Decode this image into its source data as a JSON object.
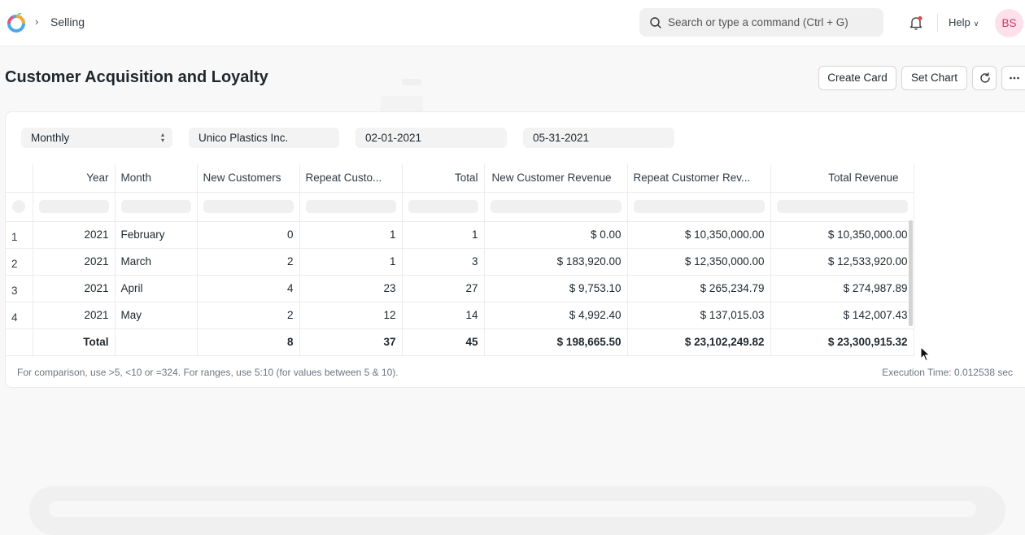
{
  "navbar": {
    "breadcrumb": "Selling",
    "search_placeholder": "Search or type a command (Ctrl + G)",
    "help_label": "Help",
    "avatar_initials": "BS"
  },
  "page": {
    "title": "Customer Acquisition and Loyalty",
    "buttons": {
      "create_card": "Create Card",
      "set_chart": "Set Chart"
    }
  },
  "filters": {
    "period": "Monthly",
    "customer": "Unico Plastics Inc.",
    "from_date": "02-01-2021",
    "to_date": "05-31-2021"
  },
  "table": {
    "columns": [
      "Year",
      "Month",
      "New Customers",
      "Repeat Custo...",
      "Total",
      "New Customer Revenue",
      "Repeat Customer Rev...",
      "Total Revenue"
    ],
    "rows": [
      {
        "no": "1",
        "year": "2021",
        "month": "February",
        "new_customers": "0",
        "repeat_customers": "1",
        "total": "1",
        "new_revenue": "$ 0.00",
        "repeat_revenue": "$ 10,350,000.00",
        "total_revenue": "$ 10,350,000.00"
      },
      {
        "no": "2",
        "year": "2021",
        "month": "March",
        "new_customers": "2",
        "repeat_customers": "1",
        "total": "3",
        "new_revenue": "$ 183,920.00",
        "repeat_revenue": "$ 12,350,000.00",
        "total_revenue": "$ 12,533,920.00"
      },
      {
        "no": "3",
        "year": "2021",
        "month": "April",
        "new_customers": "4",
        "repeat_customers": "23",
        "total": "27",
        "new_revenue": "$ 9,753.10",
        "repeat_revenue": "$ 265,234.79",
        "total_revenue": "$ 274,987.89"
      },
      {
        "no": "4",
        "year": "2021",
        "month": "May",
        "new_customers": "2",
        "repeat_customers": "12",
        "total": "14",
        "new_revenue": "$ 4,992.40",
        "repeat_revenue": "$ 137,015.03",
        "total_revenue": "$ 142,007.43"
      }
    ],
    "totals": {
      "label": "Total",
      "new_customers": "8",
      "repeat_customers": "37",
      "total": "45",
      "new_revenue": "$ 198,665.50",
      "repeat_revenue": "$ 23,102,249.82",
      "total_revenue": "$ 23,300,915.32"
    }
  },
  "footer": {
    "hint": "For comparison, use >5, <10 or =324. For ranges, use 5:10 (for values between 5 & 10).",
    "execution_time": "Execution Time: 0.012538 sec"
  },
  "icons": {
    "logo": "app-logo-icon",
    "breadcrumb_separator": "chevron-right-icon",
    "search": "search-icon",
    "notifications": "bell-icon",
    "refresh": "refresh-icon",
    "more": "more-horizontal-icon",
    "cursor": "mouse-pointer-icon"
  },
  "colors": {
    "avatar_bg": "#fde0ea",
    "avatar_text": "#d1336b",
    "notification_dot": "#e24c4c"
  }
}
